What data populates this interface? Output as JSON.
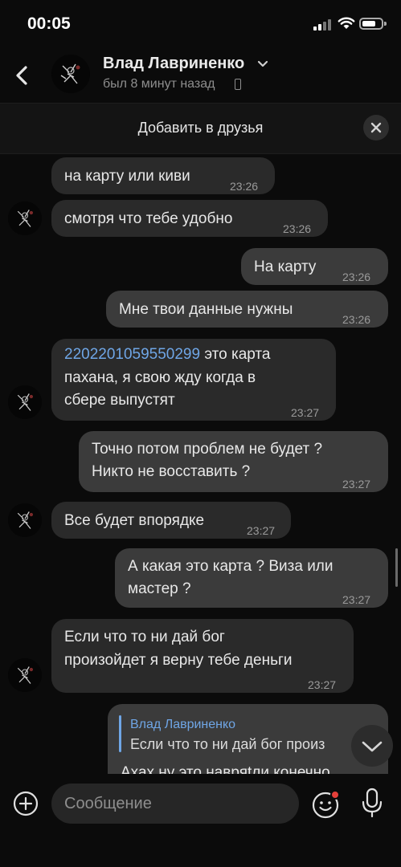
{
  "status_bar": {
    "time": "00:05"
  },
  "header": {
    "contact_name": "Влад Лавриненко",
    "last_seen": "был 8 минут назад"
  },
  "friend_banner": {
    "label": "Добавить в друзья"
  },
  "messages": [
    {
      "dir": "in",
      "text": "на карту или киви",
      "time": "23:26"
    },
    {
      "dir": "in",
      "text": "смотря что тебе удобно",
      "time": "23:26"
    },
    {
      "dir": "out",
      "text": "На карту",
      "time": "23:26"
    },
    {
      "dir": "out",
      "text": "Мне твои данные нужны",
      "time": "23:26"
    },
    {
      "dir": "in",
      "link": "2202201059550299",
      "line1_rest": " это карта",
      "line2": "пахана, я свою жду когда в",
      "line3": "сбере выпустят",
      "time": "23:27"
    },
    {
      "dir": "out",
      "line1": "Точно потом проблем не будет ?",
      "line2": "Никто не восставить ?",
      "time": "23:27"
    },
    {
      "dir": "in",
      "text": "Все будет впорядке",
      "time": "23:27"
    },
    {
      "dir": "out",
      "line1": "А какая это карта ? Виза или",
      "line2": "мастер ?",
      "time": "23:27"
    },
    {
      "dir": "in",
      "line1": "Если что то ни дай бог",
      "line2": "произойдет я верну тебе деньги",
      "time": "23:27"
    },
    {
      "dir": "out",
      "reply_author": "Влад Лавриненко",
      "reply_text": "Если что то ни дай бог произ",
      "text": "Ахах ну это навряtли конечно"
    }
  ],
  "input": {
    "placeholder": "Сообщение"
  },
  "colors": {
    "background": "#0b0b0b",
    "incoming_bubble": "#2a2a2a",
    "outgoing_bubble": "#3b3b3b",
    "link": "#6fa6e6",
    "notification_dot": "#e5403a"
  }
}
